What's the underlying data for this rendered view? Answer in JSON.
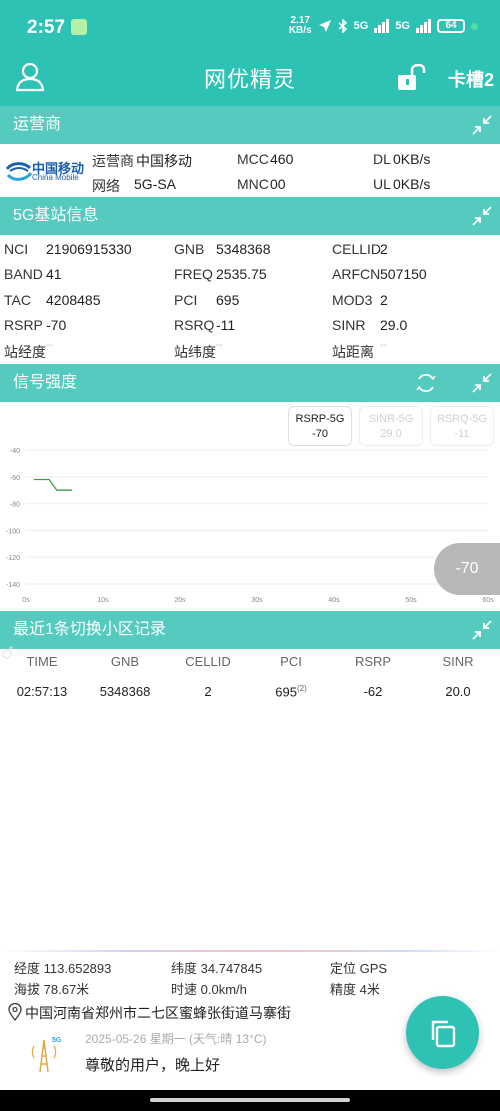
{
  "status_bar": {
    "time": "2:57",
    "speed_value": "2.17",
    "speed_unit": "KB/s",
    "net1": "5G",
    "net2": "5G",
    "battery": "64"
  },
  "app_bar": {
    "title": "网优精灵",
    "slot": "卡槽2",
    "icons": [
      "user-icon",
      "unlock-icon"
    ]
  },
  "operator": {
    "header": "运营商",
    "logo_cn": "中国移动",
    "logo_en": "China Mobile",
    "carrier_label": "运营商",
    "carrier_value": "中国移动",
    "network_label": "网络",
    "network_value": "5G-SA",
    "mcc_label": "MCC",
    "mcc_value": "460",
    "mnc_label": "MNC",
    "mnc_value": "00",
    "dl_label": "DL",
    "dl_value": "0KB/s",
    "ul_label": "UL",
    "ul_value": "0KB/s"
  },
  "cell_info": {
    "header": "5G基站信息",
    "nci_label": "NCI",
    "nci": "21906915330",
    "gnb_label": "GNB",
    "gnb": "5348368",
    "cellid_label": "CELLID",
    "cellid": "2",
    "band_label": "BAND",
    "band": "41",
    "freq_label": "FREQ",
    "freq": "2535.75",
    "arfcn_label": "ARFCN",
    "arfcn": "507150",
    "tac_label": "TAC",
    "tac": "4208485",
    "pci_label": "PCI",
    "pci": "695",
    "mod3_label": "MOD3",
    "mod3": "2",
    "rsrp_label": "RSRP",
    "rsrp": "-70",
    "rsrq_label": "RSRQ",
    "rsrq": "-11",
    "sinr_label": "SINR",
    "sinr": "29.0",
    "lon_label": "站经度",
    "lon": "--",
    "lat_label": "站纬度",
    "lat": "--",
    "dist_label": "站距离",
    "dist": "--"
  },
  "signal": {
    "header": "信号强度",
    "chips": [
      {
        "label": "RSRP-5G",
        "value": "-70"
      },
      {
        "label": "SINR-5G",
        "value": "29.0"
      },
      {
        "label": "RSRQ-5G",
        "value": "-11"
      }
    ],
    "current": "-70"
  },
  "chart_data": {
    "type": "line",
    "title": "",
    "xlabel": "",
    "ylabel": "",
    "x_ticks": [
      "0s",
      "10s",
      "20s",
      "30s",
      "40s",
      "50s",
      "60s"
    ],
    "y_ticks": [
      "-40",
      "-60",
      "-80",
      "-100",
      "-120",
      "-140"
    ],
    "ylim": [
      -140,
      -40
    ],
    "xlim": [
      0,
      60
    ],
    "grid": true,
    "series": [
      {
        "name": "RSRP-5G",
        "color": "#3e9e3e",
        "x": [
          1,
          3,
          4,
          5,
          6
        ],
        "y": [
          -62,
          -62,
          -70,
          -70,
          -70
        ]
      }
    ]
  },
  "history": {
    "header": "最近1条切换小区记录",
    "columns": [
      "TIME",
      "GNB",
      "CELLID",
      "PCI",
      "RSRP",
      "SINR"
    ],
    "rows": [
      {
        "time": "02:57:13",
        "gnb": "5348368",
        "cellid": "2",
        "pci": "695",
        "pci_sup": "(2)",
        "rsrp": "-62",
        "sinr": "20.0"
      }
    ]
  },
  "location": {
    "lon_label": "经度",
    "lon": "113.652893",
    "lat_label": "纬度",
    "lat": "34.747845",
    "fix_label": "定位",
    "fix": "GPS",
    "alt_label": "海拔",
    "alt": "78.67米",
    "speed_label": "时速",
    "speed": "0.0km/h",
    "acc_label": "精度",
    "acc": "4米",
    "address": "中国河南省郑州市二七区蜜蜂张街道马寨街",
    "date": "2025-05-26 星期一 (天气:晴 13°C)",
    "greeting": "尊敬的用户，晚上好"
  },
  "colors": {
    "primary": "#2ec2b4",
    "section": "#55cbc0",
    "line": "#3e9e3e"
  }
}
